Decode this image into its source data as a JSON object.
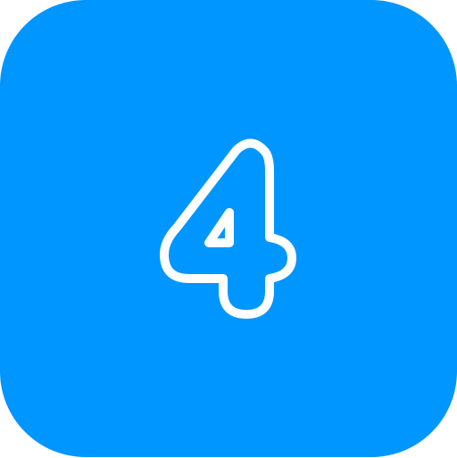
{
  "icon": {
    "name": "number-four-icon",
    "digit": "4",
    "background_color": "#0096FF",
    "stroke_color": "#FFFFFF"
  }
}
